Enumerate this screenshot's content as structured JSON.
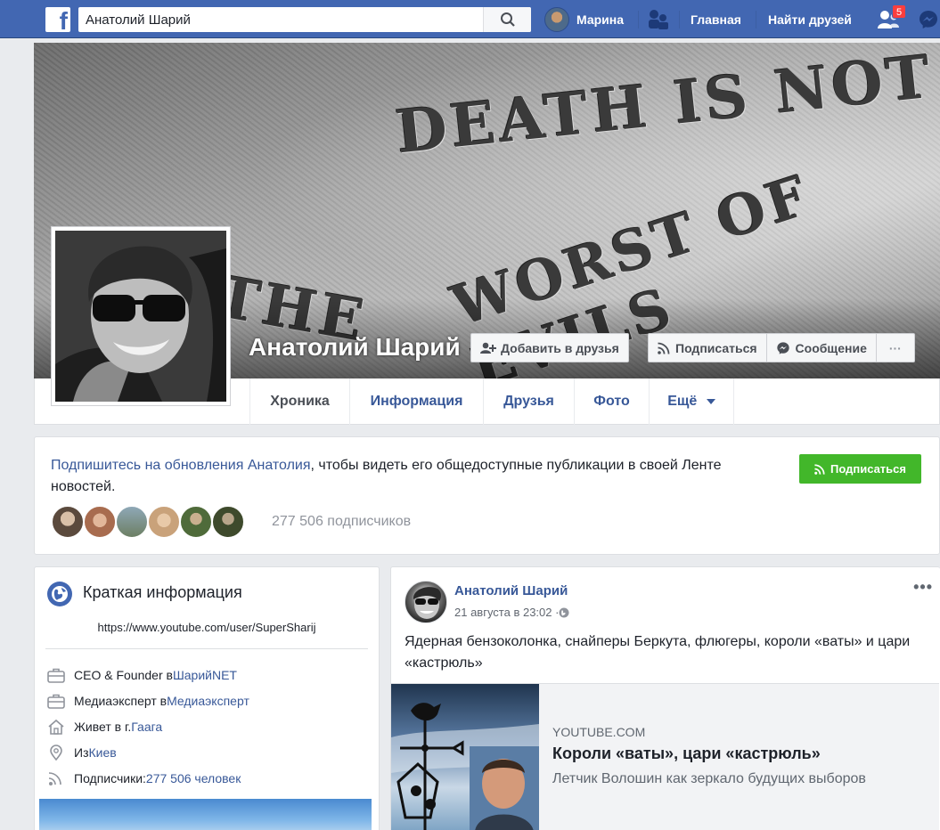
{
  "topbar": {
    "logo_letter": "f",
    "search_value": "Анатолий Шарий",
    "user_name": "Марина",
    "home_label": "Главная",
    "find_friends_label": "Найти друзей",
    "friend_requests_badge": "5"
  },
  "cover": {
    "line1": "DEATH IS NOT",
    "line2_the": "THE",
    "line2_rest": "WORST OF EVILS"
  },
  "profile": {
    "name": "Анатолий Шарий",
    "add_friend_label": "Добавить в друзья",
    "follow_label": "Подписаться",
    "message_label": "Сообщение",
    "more_label": "···"
  },
  "tabs": [
    {
      "label": "Хроника"
    },
    {
      "label": "Информация"
    },
    {
      "label": "Друзья"
    },
    {
      "label": "Фото"
    },
    {
      "label": "Ещё"
    }
  ],
  "follow_card": {
    "link_text": "Подпишитесь на обновления Анатолия",
    "rest_text": ", чтобы видеть его общедоступные публикации в своей Ленте новостей.",
    "button_label": "Подписаться",
    "followers_count": "277 506 подписчиков",
    "face_colors": [
      "#5b4a3d",
      "#a86c4f",
      "#8fa8b7",
      "#c9a27a",
      "#4f6b3a",
      "#3e4a2c"
    ]
  },
  "intro": {
    "title": "Краткая информация",
    "website": "https://www.youtube.com/user/SuperSharij",
    "rows": [
      {
        "icon": "briefcase-icon",
        "prefix": "CEO & Founder в ",
        "link": "ШарийNET"
      },
      {
        "icon": "briefcase-icon",
        "prefix": "Медиаэксперт в ",
        "link": "Медиаэксперт"
      },
      {
        "icon": "home-icon",
        "prefix": "Живет в г. ",
        "link": "Гаага"
      },
      {
        "icon": "location-pin-icon",
        "prefix": "Из ",
        "link": "Киев"
      },
      {
        "icon": "rss-icon",
        "prefix": "Подписчики: ",
        "link": "277 506 человек"
      }
    ]
  },
  "post": {
    "author": "Анатолий Шарий",
    "time": "21 августа в 23:02 · ",
    "more": "•••",
    "text": "Ядерная бензоколонка, снайперы Беркута, флюгеры, короли «ваты» и цари «кастрюль»",
    "link_domain": "YOUTUBE.COM",
    "link_title": "Короли «ваты», цари «кастрюль»",
    "link_desc": "Летчик Волошин как зеркало будущих выборов"
  }
}
